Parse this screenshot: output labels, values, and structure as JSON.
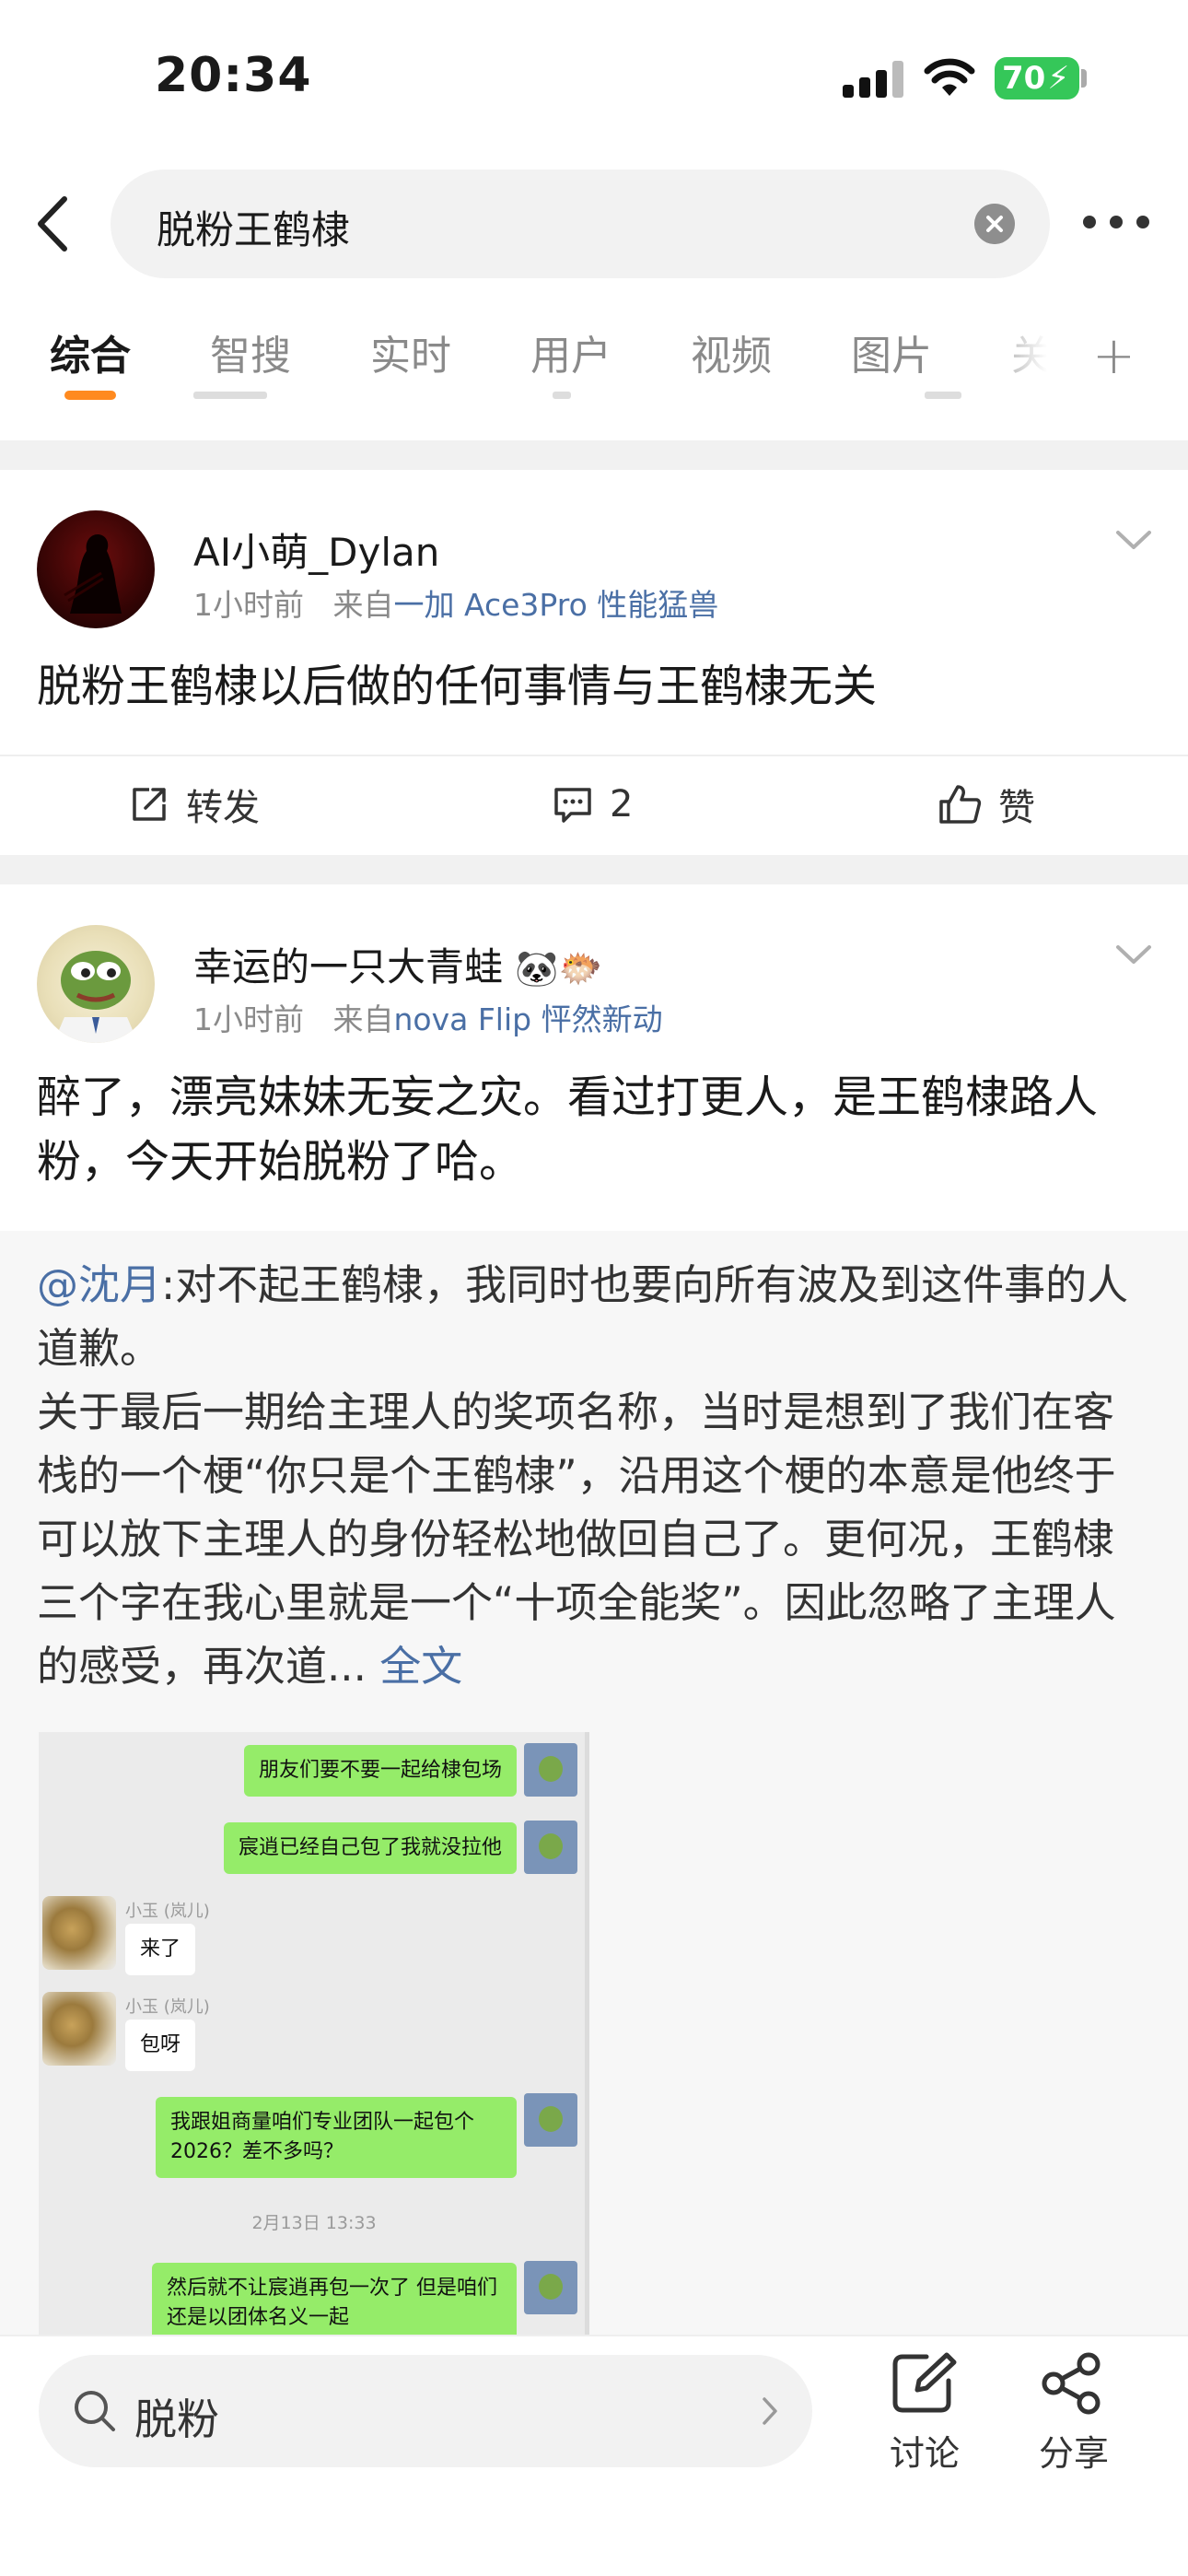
{
  "status_bar": {
    "time": "20:34",
    "battery": "70"
  },
  "search": {
    "query": "脱粉王鹤棣"
  },
  "tabs": [
    {
      "label": "综合",
      "active": true
    },
    {
      "label": "智搜",
      "active": false
    },
    {
      "label": "实时",
      "active": false
    },
    {
      "label": "用户",
      "active": false
    },
    {
      "label": "视频",
      "active": false
    },
    {
      "label": "图片",
      "active": false
    },
    {
      "label": "关",
      "active": false
    }
  ],
  "posts": [
    {
      "username": "AI小萌_Dylan",
      "time": "1小时前",
      "source_prefix": "来自",
      "source": "一加 Ace3Pro 性能猛兽",
      "text": "脱粉王鹤棣以后做的任何事情与王鹤棣无关",
      "actions": {
        "repost": "转发",
        "comments": "2",
        "like": "赞"
      }
    },
    {
      "username": "幸运的一只大青蛙",
      "badges": [
        "🐼",
        "🐡"
      ],
      "time": "1小时前",
      "source_prefix": "来自",
      "source": "nova Flip 怦然新动",
      "text": "醉了，漂亮妹妹无妄之灾。看过打更人，是王鹤棣路人粉，今天开始脱粉了哈。",
      "repost": {
        "mention": "@沈月",
        "text": ":对不起王鹤棣，我同时也要向所有波及到这件事的人道歉。\n关于最后一期给主理人的奖项名称，当时是想到了我们在客栈的一个梗“你只是个王鹤棣”，沿用这个梗的本意是他终于可以放下主理人的身份轻松地做回自己了。更何况，王鹤棣三个字在我心里就是一个“十项全能奖”。因此忽略了主理人的感受，再次道...",
        "full_link": "全文",
        "chat_image": {
          "messages": [
            {
              "side": "right",
              "text": "朋友们要不要一起给棣包场"
            },
            {
              "side": "right",
              "text": "宸逍已经自己包了我就没拉他"
            },
            {
              "side": "left",
              "name": "小玉 (岚儿)",
              "text": "来了"
            },
            {
              "side": "left",
              "name": "小玉 (岚儿)",
              "text": "包呀"
            },
            {
              "side": "right",
              "text": "我跟姐商量咱们专业团队一起包个2026？差不多吗？"
            },
            {
              "side": "time",
              "text": "2月13日 13:33"
            },
            {
              "side": "right",
              "text": "然后就不让宸逍再包一次了 但是咱们还是以团体名义一起"
            }
          ]
        }
      }
    }
  ],
  "bottom_bar": {
    "search_text": "脱粉",
    "discuss_label": "讨论",
    "share_label": "分享"
  },
  "colors": {
    "accent": "#ff8a1f",
    "link": "#4a6fa5",
    "battery": "#35c759",
    "chat_green": "#95ec69"
  }
}
